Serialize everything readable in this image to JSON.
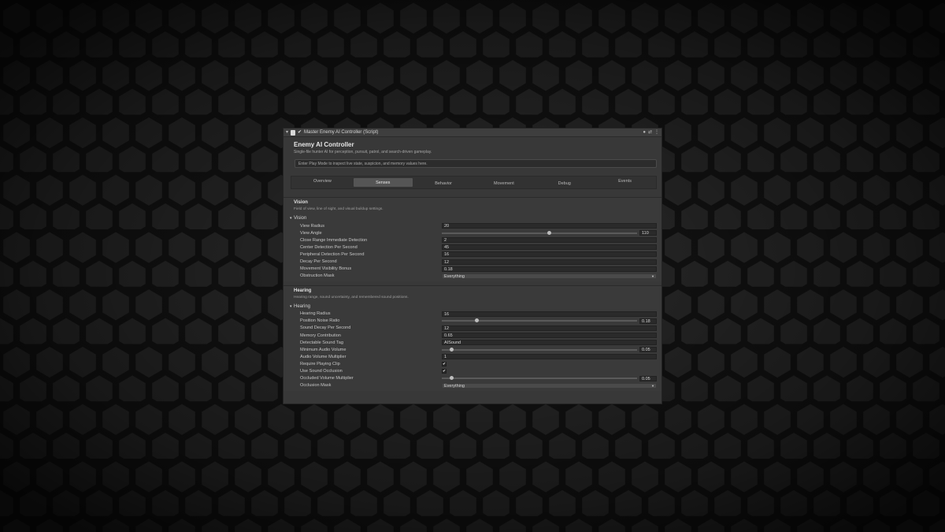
{
  "header": {
    "title": "Master Enemy AI Controller (Script)",
    "enabled": true,
    "icons": [
      "foldout-arrow-icon",
      "script-icon",
      "help-icon",
      "preset-icon",
      "kebab-menu-icon"
    ]
  },
  "component": {
    "title": "Enemy AI Controller",
    "subtitle": "Single-file hunter AI for perception, pursuit, patrol, and search-driven gameplay.",
    "info": "Enter Play Mode to inspect live state, suspicion, and memory values here."
  },
  "tabs": [
    {
      "label": "Overview",
      "active": false
    },
    {
      "label": "Senses",
      "active": true
    },
    {
      "label": "Behavior",
      "active": false
    },
    {
      "label": "Movement",
      "active": false
    },
    {
      "label": "Debug",
      "active": false
    },
    {
      "label": "Events",
      "active": false
    }
  ],
  "vision": {
    "title": "Vision",
    "desc": "Field of view, line of sight, and visual buildup settings.",
    "foldout": "Vision",
    "fields": {
      "view_radius": {
        "label": "View Radius",
        "value": "20"
      },
      "view_angle": {
        "label": "View Angle",
        "value": "110",
        "fraction": 0.55
      },
      "close_range": {
        "label": "Close Range Immediate Detection",
        "value": "2"
      },
      "center_detection": {
        "label": "Center Detection Per Second",
        "value": "45"
      },
      "peripheral_detection": {
        "label": "Peripheral Detection Per Second",
        "value": "16"
      },
      "decay": {
        "label": "Decay Per Second",
        "value": "12"
      },
      "movement_bonus": {
        "label": "Movement Visibility Bonus",
        "value": "0.18"
      },
      "obstruction_mask": {
        "label": "Obstruction Mask",
        "value": "Everything"
      }
    }
  },
  "hearing": {
    "title": "Hearing",
    "desc": "Hearing range, sound uncertainty, and remembered sound positions.",
    "foldout": "Hearing",
    "fields": {
      "hearing_radius": {
        "label": "Hearing Radius",
        "value": "16"
      },
      "position_noise": {
        "label": "Position Noise Ratio",
        "value": "0.18",
        "fraction": 0.18
      },
      "sound_decay": {
        "label": "Sound Decay Per Second",
        "value": "12"
      },
      "memory_contribution": {
        "label": "Memory Contribution",
        "value": "0.65"
      },
      "sound_tag": {
        "label": "Detectable Sound Tag",
        "value": "AISound"
      },
      "min_audio": {
        "label": "Minimum Audio Volume",
        "value": "0.05",
        "fraction": 0.05
      },
      "audio_multiplier": {
        "label": "Audio Volume Multiplier",
        "value": "1"
      },
      "require_playing": {
        "label": "Require Playing Clip",
        "checked": true
      },
      "use_occlusion": {
        "label": "Use Sound Occlusion",
        "checked": true
      },
      "occluded_multiplier": {
        "label": "Occluded Volume Multiplier",
        "value": "0.05",
        "fraction": 0.05
      },
      "occlusion_mask": {
        "label": "Occlusion Mask",
        "value": "Everything"
      }
    }
  },
  "colors": {
    "panel": "#383838",
    "field": "#2a2a2a",
    "active_tab": "#555555",
    "text": "#c8c8c8"
  }
}
